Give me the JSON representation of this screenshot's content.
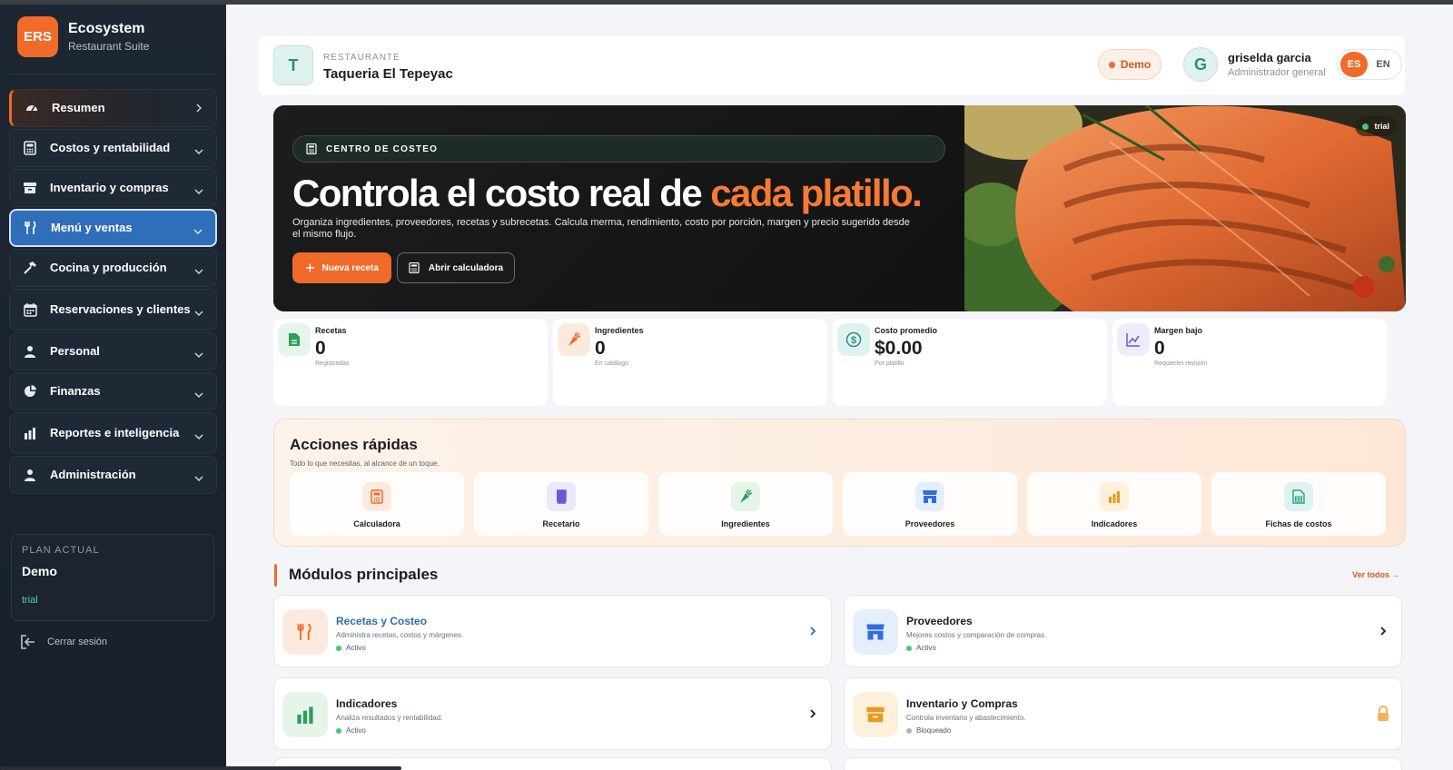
{
  "brand": {
    "logo": "ERS",
    "name": "Ecosystem",
    "subtitle": "Restaurant Suite"
  },
  "sidebar": {
    "items": [
      {
        "label": "Resumen",
        "icon": "gauge-icon",
        "state": "active"
      },
      {
        "label": "Costos y rentabilidad",
        "icon": "calculator-icon"
      },
      {
        "label": "Inventario y compras",
        "icon": "box-icon"
      },
      {
        "label": "Menú y ventas",
        "icon": "utensils-icon",
        "state": "selected"
      },
      {
        "label": "Cocina y producción",
        "icon": "hammer-icon"
      },
      {
        "label": "Reservaciones y clientes",
        "icon": "calendar-icon"
      },
      {
        "label": "Personal",
        "icon": "user-icon"
      },
      {
        "label": "Finanzas",
        "icon": "pie-icon"
      },
      {
        "label": "Reportes e inteligencia",
        "icon": "bar-chart-icon"
      },
      {
        "label": "Administración",
        "icon": "user-icon"
      }
    ],
    "plan": {
      "title": "PLAN ACTUAL",
      "name": "Demo",
      "status": "trial"
    },
    "logout": "Cerrar sesión"
  },
  "header": {
    "restaurant_initial": "T",
    "restaurant_label": "RESTAURANTE",
    "restaurant_name": "Taqueria El Tepeyac",
    "mode_badge": "Demo",
    "user_initial": "G",
    "user_name": "griselda garcia",
    "user_role": "Administrador general",
    "lang_active": "ES",
    "lang_other": "EN"
  },
  "hero": {
    "tag": "CENTRO DE COSTEO",
    "title_main": "Controla el costo real de ",
    "title_accent": "cada platillo.",
    "description": "Organiza ingredientes, proveedores, recetas y subrecetas. Calcula merma, rendimiento, costo por porción, margen y precio sugerido desde el mismo flujo.",
    "primary_button": "Nueva receta",
    "secondary_button": "Abrir calculadora",
    "image_badge": "trial"
  },
  "stats": [
    {
      "label": "Recetas",
      "value": "0",
      "sub": "Registradas",
      "icon": "document-icon",
      "color": "#2f9e5a",
      "bg": "#e6f5ea"
    },
    {
      "label": "Ingredientes",
      "value": "0",
      "sub": "En catálogo",
      "icon": "carrot-icon",
      "color": "#f06a2a",
      "bg": "#fdeadf"
    },
    {
      "label": "Costo promedio",
      "value": "$0.00",
      "sub": "Por platillo",
      "icon": "dollar-icon",
      "color": "#2d8d80",
      "bg": "#e0f2f0"
    },
    {
      "label": "Margen bajo",
      "value": "0",
      "sub": "Requieren revisión",
      "icon": "trend-icon",
      "color": "#6a5acd",
      "bg": "#efedfb"
    }
  ],
  "quick_actions": {
    "title": "Acciones rápidas",
    "subtitle": "Todo lo que necesitas, al alcance de un toque.",
    "items": [
      {
        "label": "Calculadora",
        "icon": "calculator-icon",
        "color": "#f06a2a",
        "bg": "#fdeadf"
      },
      {
        "label": "Recetario",
        "icon": "book-icon",
        "color": "#6a5acd",
        "bg": "#ebe8fb"
      },
      {
        "label": "Ingredientes",
        "icon": "carrot-icon",
        "color": "#2f9e5a",
        "bg": "#e6f5ea"
      },
      {
        "label": "Proveedores",
        "icon": "store-icon",
        "color": "#2f6ee0",
        "bg": "#e5eefc"
      },
      {
        "label": "Indicadores",
        "icon": "bar-chart-icon",
        "color": "#e89a1e",
        "bg": "#fdf1dc"
      },
      {
        "label": "Fichas de costos",
        "icon": "sheet-icon",
        "color": "#2d9d8a",
        "bg": "#def3ef"
      }
    ]
  },
  "modules": {
    "title": "Módulos principales",
    "see_all": "Ver todos →",
    "items": [
      {
        "name": "Recetas y Costeo",
        "desc": "Administra recetas, costos y márgenes.",
        "status": "Activo",
        "icon": "utensils-icon",
        "color": "#f06a2a",
        "bg": "#fdeadf"
      },
      {
        "name": "Proveedores",
        "desc": "Mejores costos y comparación de compras.",
        "status": "Activo",
        "icon": "store-icon",
        "color": "#2f6ee0",
        "bg": "#e5eefc"
      },
      {
        "name": "Indicadores",
        "desc": "Analiza resultados y rentabilidad.",
        "status": "Activo",
        "icon": "bar-chart-icon",
        "color": "#2f9e5a",
        "bg": "#e6f5ea"
      },
      {
        "name": "Inventario y Compras",
        "desc": "Controla inventario y abastecimiento.",
        "status": "Bloqueado",
        "icon": "box-icon",
        "color": "#e89a1e",
        "bg": "#fdf1dc"
      }
    ]
  }
}
